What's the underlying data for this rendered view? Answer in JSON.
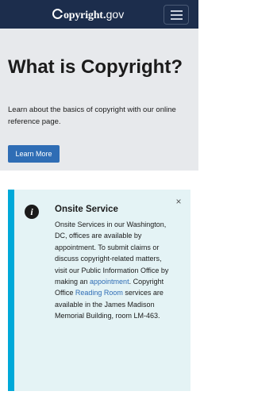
{
  "navbar": {
    "logo_main": "opyright",
    "logo_dot": ".",
    "logo_gov": "gov",
    "menu_label": "Menu"
  },
  "hero": {
    "title": "What is Copyright?",
    "description": "Learn about the basics of copyright with our online reference page.",
    "button_label": "Learn More"
  },
  "alert": {
    "heading": "Onsite Service",
    "close_symbol": "×",
    "info_symbol": "i",
    "text_1": "Onsite Services in our Washington, DC, offices are available by appointment. To submit claims or discuss copyright-related matters, visit our Public Information Office by making an ",
    "link_appointment": "appointment",
    "text_2": ". Copyright Office ",
    "link_reading_room": "Reading Room",
    "text_3": " services are available in the James Madison Memorial Building, room LM-463."
  },
  "colors": {
    "navbar_bg": "#1c2d4c",
    "hero_bg": "#e7e9ec",
    "primary_button": "#2f6db5",
    "alert_bg": "#e4f3f5",
    "alert_accent": "#00a9d9"
  },
  "icons": {
    "logo": "copyright-c-icon",
    "menu": "hamburger-menu-icon",
    "info": "info-circle-icon",
    "close": "close-icon"
  }
}
